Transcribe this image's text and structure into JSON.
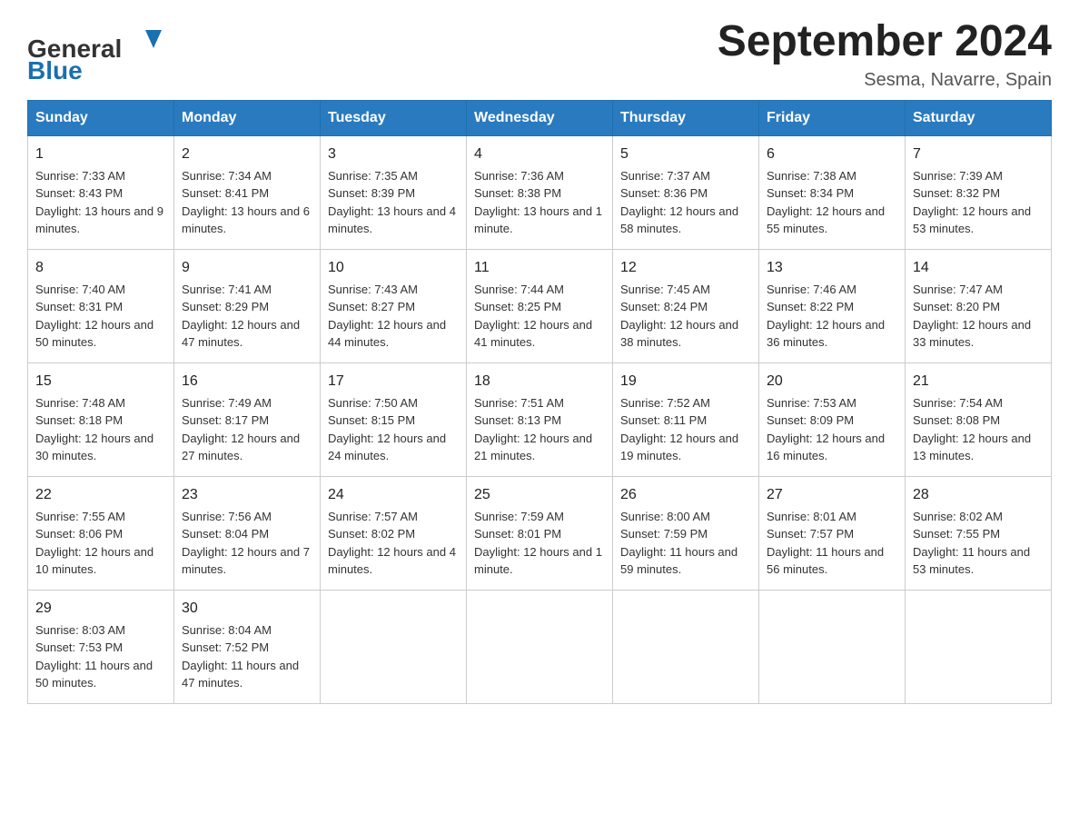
{
  "header": {
    "title": "September 2024",
    "subtitle": "Sesma, Navarre, Spain"
  },
  "weekdays": [
    "Sunday",
    "Monday",
    "Tuesday",
    "Wednesday",
    "Thursday",
    "Friday",
    "Saturday"
  ],
  "weeks": [
    [
      {
        "day": "1",
        "sunrise": "7:33 AM",
        "sunset": "8:43 PM",
        "daylight": "13 hours and 9 minutes."
      },
      {
        "day": "2",
        "sunrise": "7:34 AM",
        "sunset": "8:41 PM",
        "daylight": "13 hours and 6 minutes."
      },
      {
        "day": "3",
        "sunrise": "7:35 AM",
        "sunset": "8:39 PM",
        "daylight": "13 hours and 4 minutes."
      },
      {
        "day": "4",
        "sunrise": "7:36 AM",
        "sunset": "8:38 PM",
        "daylight": "13 hours and 1 minute."
      },
      {
        "day": "5",
        "sunrise": "7:37 AM",
        "sunset": "8:36 PM",
        "daylight": "12 hours and 58 minutes."
      },
      {
        "day": "6",
        "sunrise": "7:38 AM",
        "sunset": "8:34 PM",
        "daylight": "12 hours and 55 minutes."
      },
      {
        "day": "7",
        "sunrise": "7:39 AM",
        "sunset": "8:32 PM",
        "daylight": "12 hours and 53 minutes."
      }
    ],
    [
      {
        "day": "8",
        "sunrise": "7:40 AM",
        "sunset": "8:31 PM",
        "daylight": "12 hours and 50 minutes."
      },
      {
        "day": "9",
        "sunrise": "7:41 AM",
        "sunset": "8:29 PM",
        "daylight": "12 hours and 47 minutes."
      },
      {
        "day": "10",
        "sunrise": "7:43 AM",
        "sunset": "8:27 PM",
        "daylight": "12 hours and 44 minutes."
      },
      {
        "day": "11",
        "sunrise": "7:44 AM",
        "sunset": "8:25 PM",
        "daylight": "12 hours and 41 minutes."
      },
      {
        "day": "12",
        "sunrise": "7:45 AM",
        "sunset": "8:24 PM",
        "daylight": "12 hours and 38 minutes."
      },
      {
        "day": "13",
        "sunrise": "7:46 AM",
        "sunset": "8:22 PM",
        "daylight": "12 hours and 36 minutes."
      },
      {
        "day": "14",
        "sunrise": "7:47 AM",
        "sunset": "8:20 PM",
        "daylight": "12 hours and 33 minutes."
      }
    ],
    [
      {
        "day": "15",
        "sunrise": "7:48 AM",
        "sunset": "8:18 PM",
        "daylight": "12 hours and 30 minutes."
      },
      {
        "day": "16",
        "sunrise": "7:49 AM",
        "sunset": "8:17 PM",
        "daylight": "12 hours and 27 minutes."
      },
      {
        "day": "17",
        "sunrise": "7:50 AM",
        "sunset": "8:15 PM",
        "daylight": "12 hours and 24 minutes."
      },
      {
        "day": "18",
        "sunrise": "7:51 AM",
        "sunset": "8:13 PM",
        "daylight": "12 hours and 21 minutes."
      },
      {
        "day": "19",
        "sunrise": "7:52 AM",
        "sunset": "8:11 PM",
        "daylight": "12 hours and 19 minutes."
      },
      {
        "day": "20",
        "sunrise": "7:53 AM",
        "sunset": "8:09 PM",
        "daylight": "12 hours and 16 minutes."
      },
      {
        "day": "21",
        "sunrise": "7:54 AM",
        "sunset": "8:08 PM",
        "daylight": "12 hours and 13 minutes."
      }
    ],
    [
      {
        "day": "22",
        "sunrise": "7:55 AM",
        "sunset": "8:06 PM",
        "daylight": "12 hours and 10 minutes."
      },
      {
        "day": "23",
        "sunrise": "7:56 AM",
        "sunset": "8:04 PM",
        "daylight": "12 hours and 7 minutes."
      },
      {
        "day": "24",
        "sunrise": "7:57 AM",
        "sunset": "8:02 PM",
        "daylight": "12 hours and 4 minutes."
      },
      {
        "day": "25",
        "sunrise": "7:59 AM",
        "sunset": "8:01 PM",
        "daylight": "12 hours and 1 minute."
      },
      {
        "day": "26",
        "sunrise": "8:00 AM",
        "sunset": "7:59 PM",
        "daylight": "11 hours and 59 minutes."
      },
      {
        "day": "27",
        "sunrise": "8:01 AM",
        "sunset": "7:57 PM",
        "daylight": "11 hours and 56 minutes."
      },
      {
        "day": "28",
        "sunrise": "8:02 AM",
        "sunset": "7:55 PM",
        "daylight": "11 hours and 53 minutes."
      }
    ],
    [
      {
        "day": "29",
        "sunrise": "8:03 AM",
        "sunset": "7:53 PM",
        "daylight": "11 hours and 50 minutes."
      },
      {
        "day": "30",
        "sunrise": "8:04 AM",
        "sunset": "7:52 PM",
        "daylight": "11 hours and 47 minutes."
      },
      null,
      null,
      null,
      null,
      null
    ]
  ],
  "labels": {
    "sunrise_prefix": "Sunrise: ",
    "sunset_prefix": "Sunset: ",
    "daylight_prefix": "Daylight: "
  }
}
